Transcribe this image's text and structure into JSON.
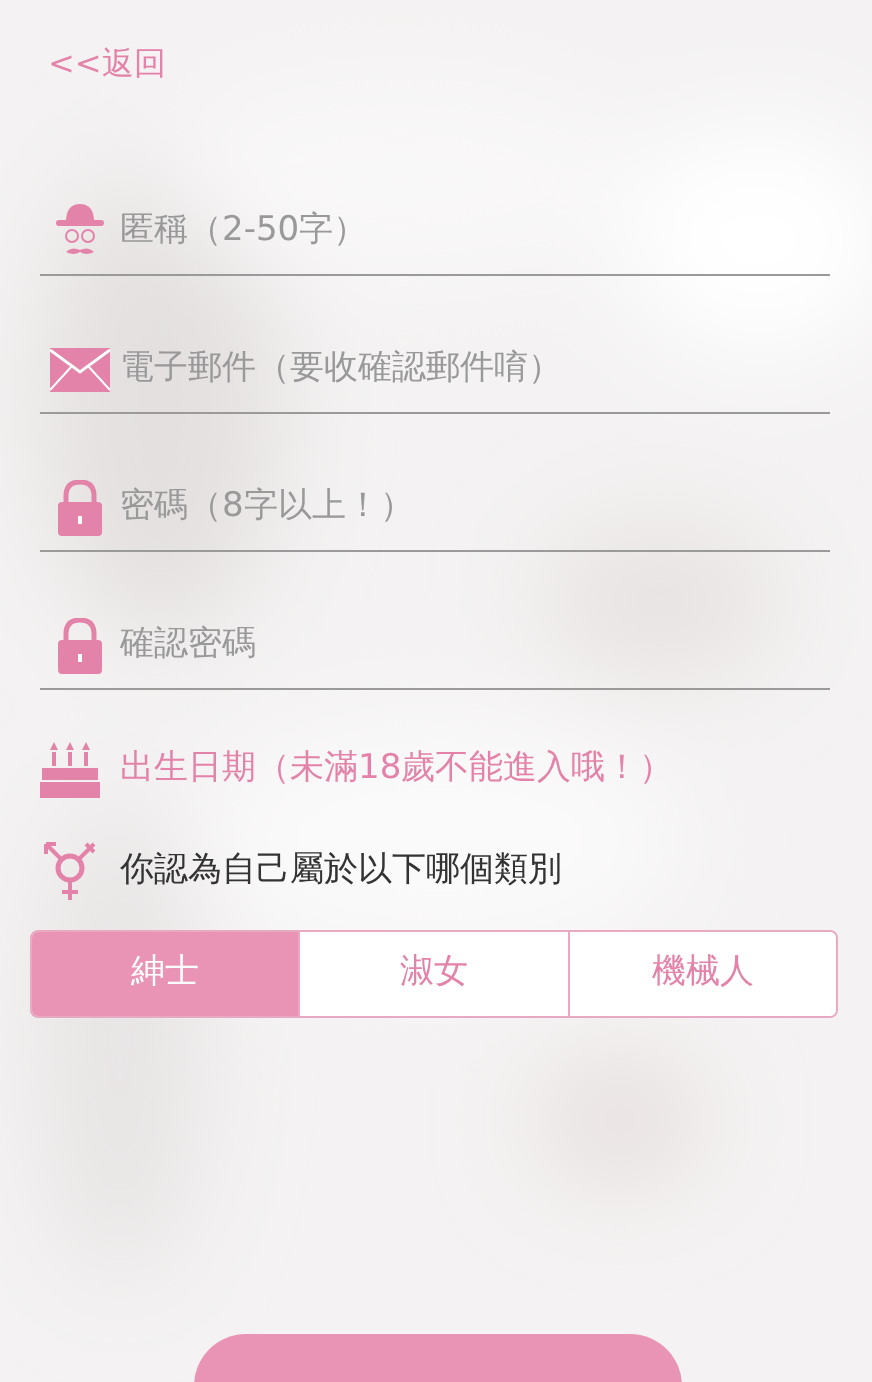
{
  "back_link": "<<返回",
  "fields": [
    {
      "kind": "hat",
      "placeholder": "匿稱（2-50字）"
    },
    {
      "kind": "mail",
      "placeholder": "電子郵件（要收確認郵件唷）"
    },
    {
      "kind": "lock",
      "placeholder": "密碼（8字以上！）"
    },
    {
      "kind": "lock",
      "placeholder": "確認密碼"
    }
  ],
  "birthday": "出生日期（未滿18歲不能進入哦！）",
  "gender_question": "你認為自己屬於以下哪個類別",
  "gender_options": [
    {
      "label": "紳士",
      "selected": true
    },
    {
      "label": "淑女",
      "selected": false
    },
    {
      "label": "機械人",
      "selected": false
    }
  ]
}
